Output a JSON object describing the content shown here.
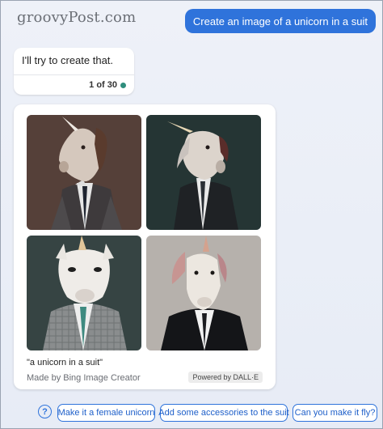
{
  "watermark": "groovyPost.com",
  "user_message": "Create an image of a unicorn in a suit",
  "bot_message": {
    "text": "I'll try to create that.",
    "turn_counter": "1 of 30"
  },
  "image_card": {
    "images": [
      {
        "name": "unicorn-suit-image-1"
      },
      {
        "name": "unicorn-suit-image-2"
      },
      {
        "name": "unicorn-suit-image-3"
      },
      {
        "name": "unicorn-suit-image-4"
      }
    ],
    "prompt": "\"a unicorn in a suit\"",
    "creator": "Made by Bing Image Creator",
    "powered_by": "Powered by DALL·E"
  },
  "suggestions": [
    "Make it a female unicorn",
    "Add some accessories to the suit",
    "Can you make it fly?"
  ],
  "colors": {
    "accent": "#2f73db",
    "status_dot": "#2f8e7d"
  }
}
